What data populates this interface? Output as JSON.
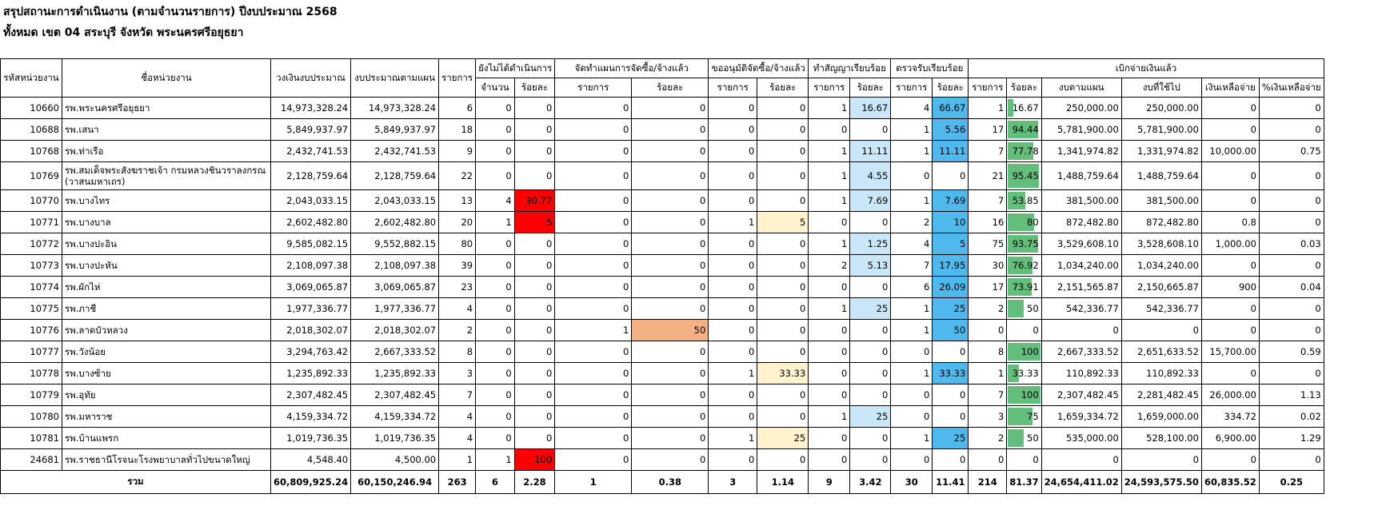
{
  "title_line1": "สรุปสถานะการดำเนินงาน (ตามจำนวนรายการ) ปีงบประมาณ 2568",
  "title_line2": "ทั้งหมด เขต 04 สระบุรี จังหวัด พระนครศรีอยุธยา",
  "headers": {
    "code": "รหัสหน่วยงาน",
    "name": "ชื่อหน่วยงาน",
    "budget": "วงเงินงบประมาณ",
    "plan_budget": "งบประมาณตามแผน",
    "items": "รายการ",
    "not_started": "ยังไม่ได้ดำเนินการ",
    "planning": "จัดทำแผนการจัดซื้อ/จ้างแล้ว",
    "approval": "ขออนุมัติจัดซื้อ/จ้างแล้ว",
    "contracted": "ทำสัญญาเรียบร้อย",
    "received": "ตรวจรับเรียบร้อย",
    "disbursed": "เบิกจ่ายเงินแล้ว",
    "count": "จำนวน",
    "percent": "ร้อยละ",
    "item": "รายการ",
    "plan_amount": "งบตามแผน",
    "used_amount": "งบที่ใช้ไป",
    "remaining": "เงินเหลือจ่าย",
    "remaining_pct": "%เงินเหลือจ่าย"
  },
  "rows": [
    {
      "code": "10660",
      "name": "รพ.พระนครศรีอยุธยา",
      "budget": "14,973,328.24",
      "plan": "14,973,328.24",
      "items": "6",
      "ns_n": "0",
      "ns_p": "0",
      "pl_n": "0",
      "pl_p": "0",
      "ap_n": "0",
      "ap_p": "0",
      "ct_n": "1",
      "ct_p": "16.67",
      "rc_n": "4",
      "rc_p": "66.67",
      "db_n": "1",
      "db_p": "16.67",
      "db_pct": 16.67,
      "plan_amt": "250,000.00",
      "used_amt": "250,000.00",
      "remain": "0",
      "remain_p": "0"
    },
    {
      "code": "10688",
      "name": "รพ.เสนา",
      "budget": "5,849,937.97",
      "plan": "5,849,937.97",
      "items": "18",
      "ns_n": "0",
      "ns_p": "0",
      "pl_n": "0",
      "pl_p": "0",
      "ap_n": "0",
      "ap_p": "0",
      "ct_n": "0",
      "ct_p": "0",
      "rc_n": "1",
      "rc_p": "5.56",
      "db_n": "17",
      "db_p": "94.44",
      "db_pct": 94.44,
      "plan_amt": "5,781,900.00",
      "used_amt": "5,781,900.00",
      "remain": "0",
      "remain_p": "0"
    },
    {
      "code": "10768",
      "name": "รพ.ท่าเรือ",
      "budget": "2,432,741.53",
      "plan": "2,432,741.53",
      "items": "9",
      "ns_n": "0",
      "ns_p": "0",
      "pl_n": "0",
      "pl_p": "0",
      "ap_n": "0",
      "ap_p": "0",
      "ct_n": "1",
      "ct_p": "11.11",
      "rc_n": "1",
      "rc_p": "11.11",
      "db_n": "7",
      "db_p": "77.78",
      "db_pct": 77.78,
      "plan_amt": "1,341,974.82",
      "used_amt": "1,331,974.82",
      "remain": "10,000.00",
      "remain_p": "0.75"
    },
    {
      "code": "10769",
      "name": "รพ.สมเด็จพระสังฆราชเจ้า กรมหลวงชินวราลงกรณ (วาสนมหาเถร)",
      "budget": "2,128,759.64",
      "plan": "2,128,759.64",
      "items": "22",
      "ns_n": "0",
      "ns_p": "0",
      "pl_n": "0",
      "pl_p": "0",
      "ap_n": "0",
      "ap_p": "0",
      "ct_n": "1",
      "ct_p": "4.55",
      "rc_n": "0",
      "rc_p": "0",
      "db_n": "21",
      "db_p": "95.45",
      "db_pct": 95.45,
      "plan_amt": "1,488,759.64",
      "used_amt": "1,488,759.64",
      "remain": "0",
      "remain_p": "0"
    },
    {
      "code": "10770",
      "name": "รพ.บางไทร",
      "budget": "2,043,033.15",
      "plan": "2,043,033.15",
      "items": "13",
      "ns_n": "4",
      "ns_p": "30.77",
      "pl_n": "0",
      "pl_p": "0",
      "ap_n": "0",
      "ap_p": "0",
      "ct_n": "1",
      "ct_p": "7.69",
      "rc_n": "1",
      "rc_p": "7.69",
      "db_n": "7",
      "db_p": "53.85",
      "db_pct": 53.85,
      "plan_amt": "381,500.00",
      "used_amt": "381,500.00",
      "remain": "0",
      "remain_p": "0"
    },
    {
      "code": "10771",
      "name": "รพ.บางบาล",
      "budget": "2,602,482.80",
      "plan": "2,602,482.80",
      "items": "20",
      "ns_n": "1",
      "ns_p": "5",
      "pl_n": "0",
      "pl_p": "0",
      "ap_n": "1",
      "ap_p": "5",
      "ct_n": "0",
      "ct_p": "0",
      "rc_n": "2",
      "rc_p": "10",
      "db_n": "16",
      "db_p": "80",
      "db_pct": 80,
      "plan_amt": "872,482.80",
      "used_amt": "872,482.80",
      "remain": "0.8",
      "remain_p": "0"
    },
    {
      "code": "10772",
      "name": "รพ.บางปะอิน",
      "budget": "9,585,082.15",
      "plan": "9,552,882.15",
      "items": "80",
      "ns_n": "0",
      "ns_p": "0",
      "pl_n": "0",
      "pl_p": "0",
      "ap_n": "0",
      "ap_p": "0",
      "ct_n": "1",
      "ct_p": "1.25",
      "rc_n": "4",
      "rc_p": "5",
      "db_n": "75",
      "db_p": "93.75",
      "db_pct": 93.75,
      "plan_amt": "3,529,608.10",
      "used_amt": "3,528,608.10",
      "remain": "1,000.00",
      "remain_p": "0.03"
    },
    {
      "code": "10773",
      "name": "รพ.บางปะหัน",
      "budget": "2,108,097.38",
      "plan": "2,108,097.38",
      "items": "39",
      "ns_n": "0",
      "ns_p": "0",
      "pl_n": "0",
      "pl_p": "0",
      "ap_n": "0",
      "ap_p": "0",
      "ct_n": "2",
      "ct_p": "5.13",
      "rc_n": "7",
      "rc_p": "17.95",
      "db_n": "30",
      "db_p": "76.92",
      "db_pct": 76.92,
      "plan_amt": "1,034,240.00",
      "used_amt": "1,034,240.00",
      "remain": "0",
      "remain_p": "0"
    },
    {
      "code": "10774",
      "name": "รพ.ผักไห่",
      "budget": "3,069,065.87",
      "plan": "3,069,065.87",
      "items": "23",
      "ns_n": "0",
      "ns_p": "0",
      "pl_n": "0",
      "pl_p": "0",
      "ap_n": "0",
      "ap_p": "0",
      "ct_n": "0",
      "ct_p": "0",
      "rc_n": "6",
      "rc_p": "26.09",
      "db_n": "17",
      "db_p": "73.91",
      "db_pct": 73.91,
      "plan_amt": "2,151,565.87",
      "used_amt": "2,150,665.87",
      "remain": "900",
      "remain_p": "0.04"
    },
    {
      "code": "10775",
      "name": "รพ.ภาชี",
      "budget": "1,977,336.77",
      "plan": "1,977,336.77",
      "items": "4",
      "ns_n": "0",
      "ns_p": "0",
      "pl_n": "0",
      "pl_p": "0",
      "ap_n": "0",
      "ap_p": "0",
      "ct_n": "1",
      "ct_p": "25",
      "rc_n": "1",
      "rc_p": "25",
      "db_n": "2",
      "db_p": "50",
      "db_pct": 50,
      "plan_amt": "542,336.77",
      "used_amt": "542,336.77",
      "remain": "0",
      "remain_p": "0"
    },
    {
      "code": "10776",
      "name": "รพ.ลาดบัวหลวง",
      "budget": "2,018,302.07",
      "plan": "2,018,302.07",
      "items": "2",
      "ns_n": "0",
      "ns_p": "0",
      "pl_n": "1",
      "pl_p": "50",
      "ap_n": "0",
      "ap_p": "0",
      "ct_n": "0",
      "ct_p": "0",
      "rc_n": "1",
      "rc_p": "50",
      "db_n": "0",
      "db_p": "0",
      "db_pct": 0,
      "plan_amt": "0",
      "used_amt": "0",
      "remain": "0",
      "remain_p": "0"
    },
    {
      "code": "10777",
      "name": "รพ.วังน้อย",
      "budget": "3,294,763.42",
      "plan": "2,667,333.52",
      "items": "8",
      "ns_n": "0",
      "ns_p": "0",
      "pl_n": "0",
      "pl_p": "0",
      "ap_n": "0",
      "ap_p": "0",
      "ct_n": "0",
      "ct_p": "0",
      "rc_n": "0",
      "rc_p": "0",
      "db_n": "8",
      "db_p": "100",
      "db_pct": 100,
      "plan_amt": "2,667,333.52",
      "used_amt": "2,651,633.52",
      "remain": "15,700.00",
      "remain_p": "0.59"
    },
    {
      "code": "10778",
      "name": "รพ.บางซ้าย",
      "budget": "1,235,892.33",
      "plan": "1,235,892.33",
      "items": "3",
      "ns_n": "0",
      "ns_p": "0",
      "pl_n": "0",
      "pl_p": "0",
      "ap_n": "1",
      "ap_p": "33.33",
      "ct_n": "0",
      "ct_p": "0",
      "rc_n": "1",
      "rc_p": "33.33",
      "db_n": "1",
      "db_p": "33.33",
      "db_pct": 33.33,
      "plan_amt": "110,892.33",
      "used_amt": "110,892.33",
      "remain": "0",
      "remain_p": "0"
    },
    {
      "code": "10779",
      "name": "รพ.อุทัย",
      "budget": "2,307,482.45",
      "plan": "2,307,482.45",
      "items": "7",
      "ns_n": "0",
      "ns_p": "0",
      "pl_n": "0",
      "pl_p": "0",
      "ap_n": "0",
      "ap_p": "0",
      "ct_n": "0",
      "ct_p": "0",
      "rc_n": "0",
      "rc_p": "0",
      "db_n": "7",
      "db_p": "100",
      "db_pct": 100,
      "plan_amt": "2,307,482.45",
      "used_amt": "2,281,482.45",
      "remain": "26,000.00",
      "remain_p": "1.13"
    },
    {
      "code": "10780",
      "name": "รพ.มหาราช",
      "budget": "4,159,334.72",
      "plan": "4,159,334.72",
      "items": "4",
      "ns_n": "0",
      "ns_p": "0",
      "pl_n": "0",
      "pl_p": "0",
      "ap_n": "0",
      "ap_p": "0",
      "ct_n": "1",
      "ct_p": "25",
      "rc_n": "0",
      "rc_p": "0",
      "db_n": "3",
      "db_p": "75",
      "db_pct": 75,
      "plan_amt": "1,659,334.72",
      "used_amt": "1,659,000.00",
      "remain": "334.72",
      "remain_p": "0.02"
    },
    {
      "code": "10781",
      "name": "รพ.บ้านแพรก",
      "budget": "1,019,736.35",
      "plan": "1,019,736.35",
      "items": "4",
      "ns_n": "0",
      "ns_p": "0",
      "pl_n": "0",
      "pl_p": "0",
      "ap_n": "1",
      "ap_p": "25",
      "ct_n": "0",
      "ct_p": "0",
      "rc_n": "1",
      "rc_p": "25",
      "db_n": "2",
      "db_p": "50",
      "db_pct": 50,
      "plan_amt": "535,000.00",
      "used_amt": "528,100.00",
      "remain": "6,900.00",
      "remain_p": "1.29"
    },
    {
      "code": "24681",
      "name": "รพ.ราชธานีโรจนะโรงพยาบาลทั่วไปขนาดใหญ่",
      "budget": "4,548.40",
      "plan": "4,500.00",
      "items": "1",
      "ns_n": "1",
      "ns_p": "100",
      "pl_n": "0",
      "pl_p": "0",
      "ap_n": "0",
      "ap_p": "0",
      "ct_n": "0",
      "ct_p": "0",
      "rc_n": "0",
      "rc_p": "0",
      "db_n": "0",
      "db_p": "0",
      "db_pct": 0,
      "plan_amt": "0",
      "used_amt": "0",
      "remain": "0",
      "remain_p": "0"
    }
  ],
  "total": {
    "label": "รวม",
    "budget": "60,809,925.24",
    "plan": "60,150,246.94",
    "items": "263",
    "ns_n": "6",
    "ns_p": "2.28",
    "pl_n": "1",
    "pl_p": "0.38",
    "ap_n": "3",
    "ap_p": "1.14",
    "ct_n": "9",
    "ct_p": "3.42",
    "rc_n": "30",
    "rc_p": "11.41",
    "db_n": "214",
    "db_p": "81.37",
    "plan_amt": "24,654,411.02",
    "used_amt": "24,593,575.50",
    "remain": "60,835.52",
    "remain_p": "0.25"
  },
  "colors": {
    "not_started_highlight": "#ff0000",
    "planning_highlight": "#f4b183",
    "approval_highlight": "#fff2cc",
    "contracted_highlight": "#c9e7f7",
    "received_highlight": "#4fb8ec",
    "disbursed_bar": "#63be7b"
  }
}
